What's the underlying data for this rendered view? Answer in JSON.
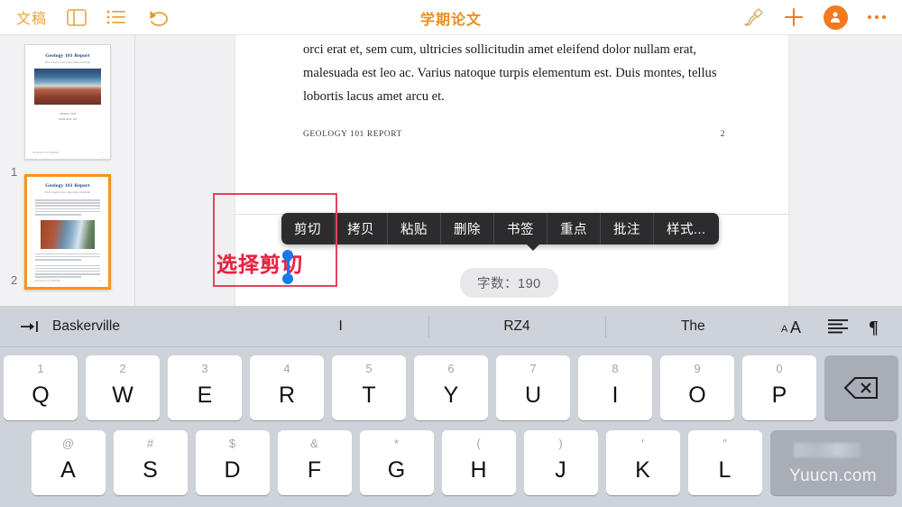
{
  "toolbar": {
    "docs_label": "文稿",
    "title": "学期论文",
    "icons": {
      "sidebar": "sidebar-toggle-icon",
      "outline": "list-outline-icon",
      "undo": "undo-icon",
      "format": "paintbrush-icon",
      "add": "plus-icon",
      "account": "account-avatar-icon",
      "more": "more-options-icon"
    },
    "accent_color": "#f08c1b"
  },
  "sidebar": {
    "thumbnails": [
      {
        "number": "1",
        "selected": false,
        "title": "Geology 101 Report",
        "subtitle": "How I learn rocks come under mountain",
        "author": "ZHANG SAN",
        "author2": "GEOLOGY 101",
        "footer_left": "GEOLOGY 101 REPORT",
        "footer_right": "1"
      },
      {
        "number": "2",
        "selected": true,
        "title": "Geology 101 Report",
        "subtitle": "How I learn rocks come under mountain",
        "footer_left": "GEOLOGY 101 REPORT",
        "footer_right": "2"
      }
    ]
  },
  "document": {
    "paragraph": "orci erat et, sem cum, ultricies sollicitudin amet eleifend dolor nullam erat, malesuada est leo ac. Varius natoque turpis elementum est. Duis montes, tellus lobortis lacus amet arcu et.",
    "footer_left": "GEOLOGY 101 REPORT",
    "footer_right": "2"
  },
  "context_menu": {
    "items": [
      {
        "label": "剪切"
      },
      {
        "label": "拷贝"
      },
      {
        "label": "粘贴"
      },
      {
        "label": "删除"
      },
      {
        "label": "书签"
      },
      {
        "label": "重点"
      },
      {
        "label": "批注"
      },
      {
        "label": "样式..."
      }
    ]
  },
  "annotation": {
    "label": "选择剪切",
    "color": "#e8203f"
  },
  "word_count": {
    "label": "字数：190"
  },
  "keyboard": {
    "format_bar": {
      "tab_icon": "tab-indent-icon",
      "font_name": "Baskerville",
      "suggestions": [
        "I",
        "RZ4",
        "The"
      ],
      "icons": {
        "text_size": "text-size-icon",
        "align": "text-align-icon",
        "paragraph": "pilcrow-icon"
      }
    },
    "row1": [
      {
        "num": "1",
        "ltr": "Q"
      },
      {
        "num": "2",
        "ltr": "W"
      },
      {
        "num": "3",
        "ltr": "E"
      },
      {
        "num": "4",
        "ltr": "R"
      },
      {
        "num": "5",
        "ltr": "T"
      },
      {
        "num": "6",
        "ltr": "Y"
      },
      {
        "num": "7",
        "ltr": "U"
      },
      {
        "num": "8",
        "ltr": "I"
      },
      {
        "num": "9",
        "ltr": "O"
      },
      {
        "num": "0",
        "ltr": "P"
      }
    ],
    "backspace_icon": "backspace-icon",
    "row2": [
      {
        "num": "@",
        "ltr": "A"
      },
      {
        "num": "#",
        "ltr": "S"
      },
      {
        "num": "$",
        "ltr": "D"
      },
      {
        "num": "&",
        "ltr": "F"
      },
      {
        "num": "*",
        "ltr": "G"
      },
      {
        "num": "(",
        "ltr": "H"
      },
      {
        "num": ")",
        "ltr": "J"
      },
      {
        "num": "'",
        "ltr": "K"
      },
      {
        "num": "\"",
        "ltr": "L"
      }
    ],
    "return_watermark": "Yuucn.com"
  }
}
